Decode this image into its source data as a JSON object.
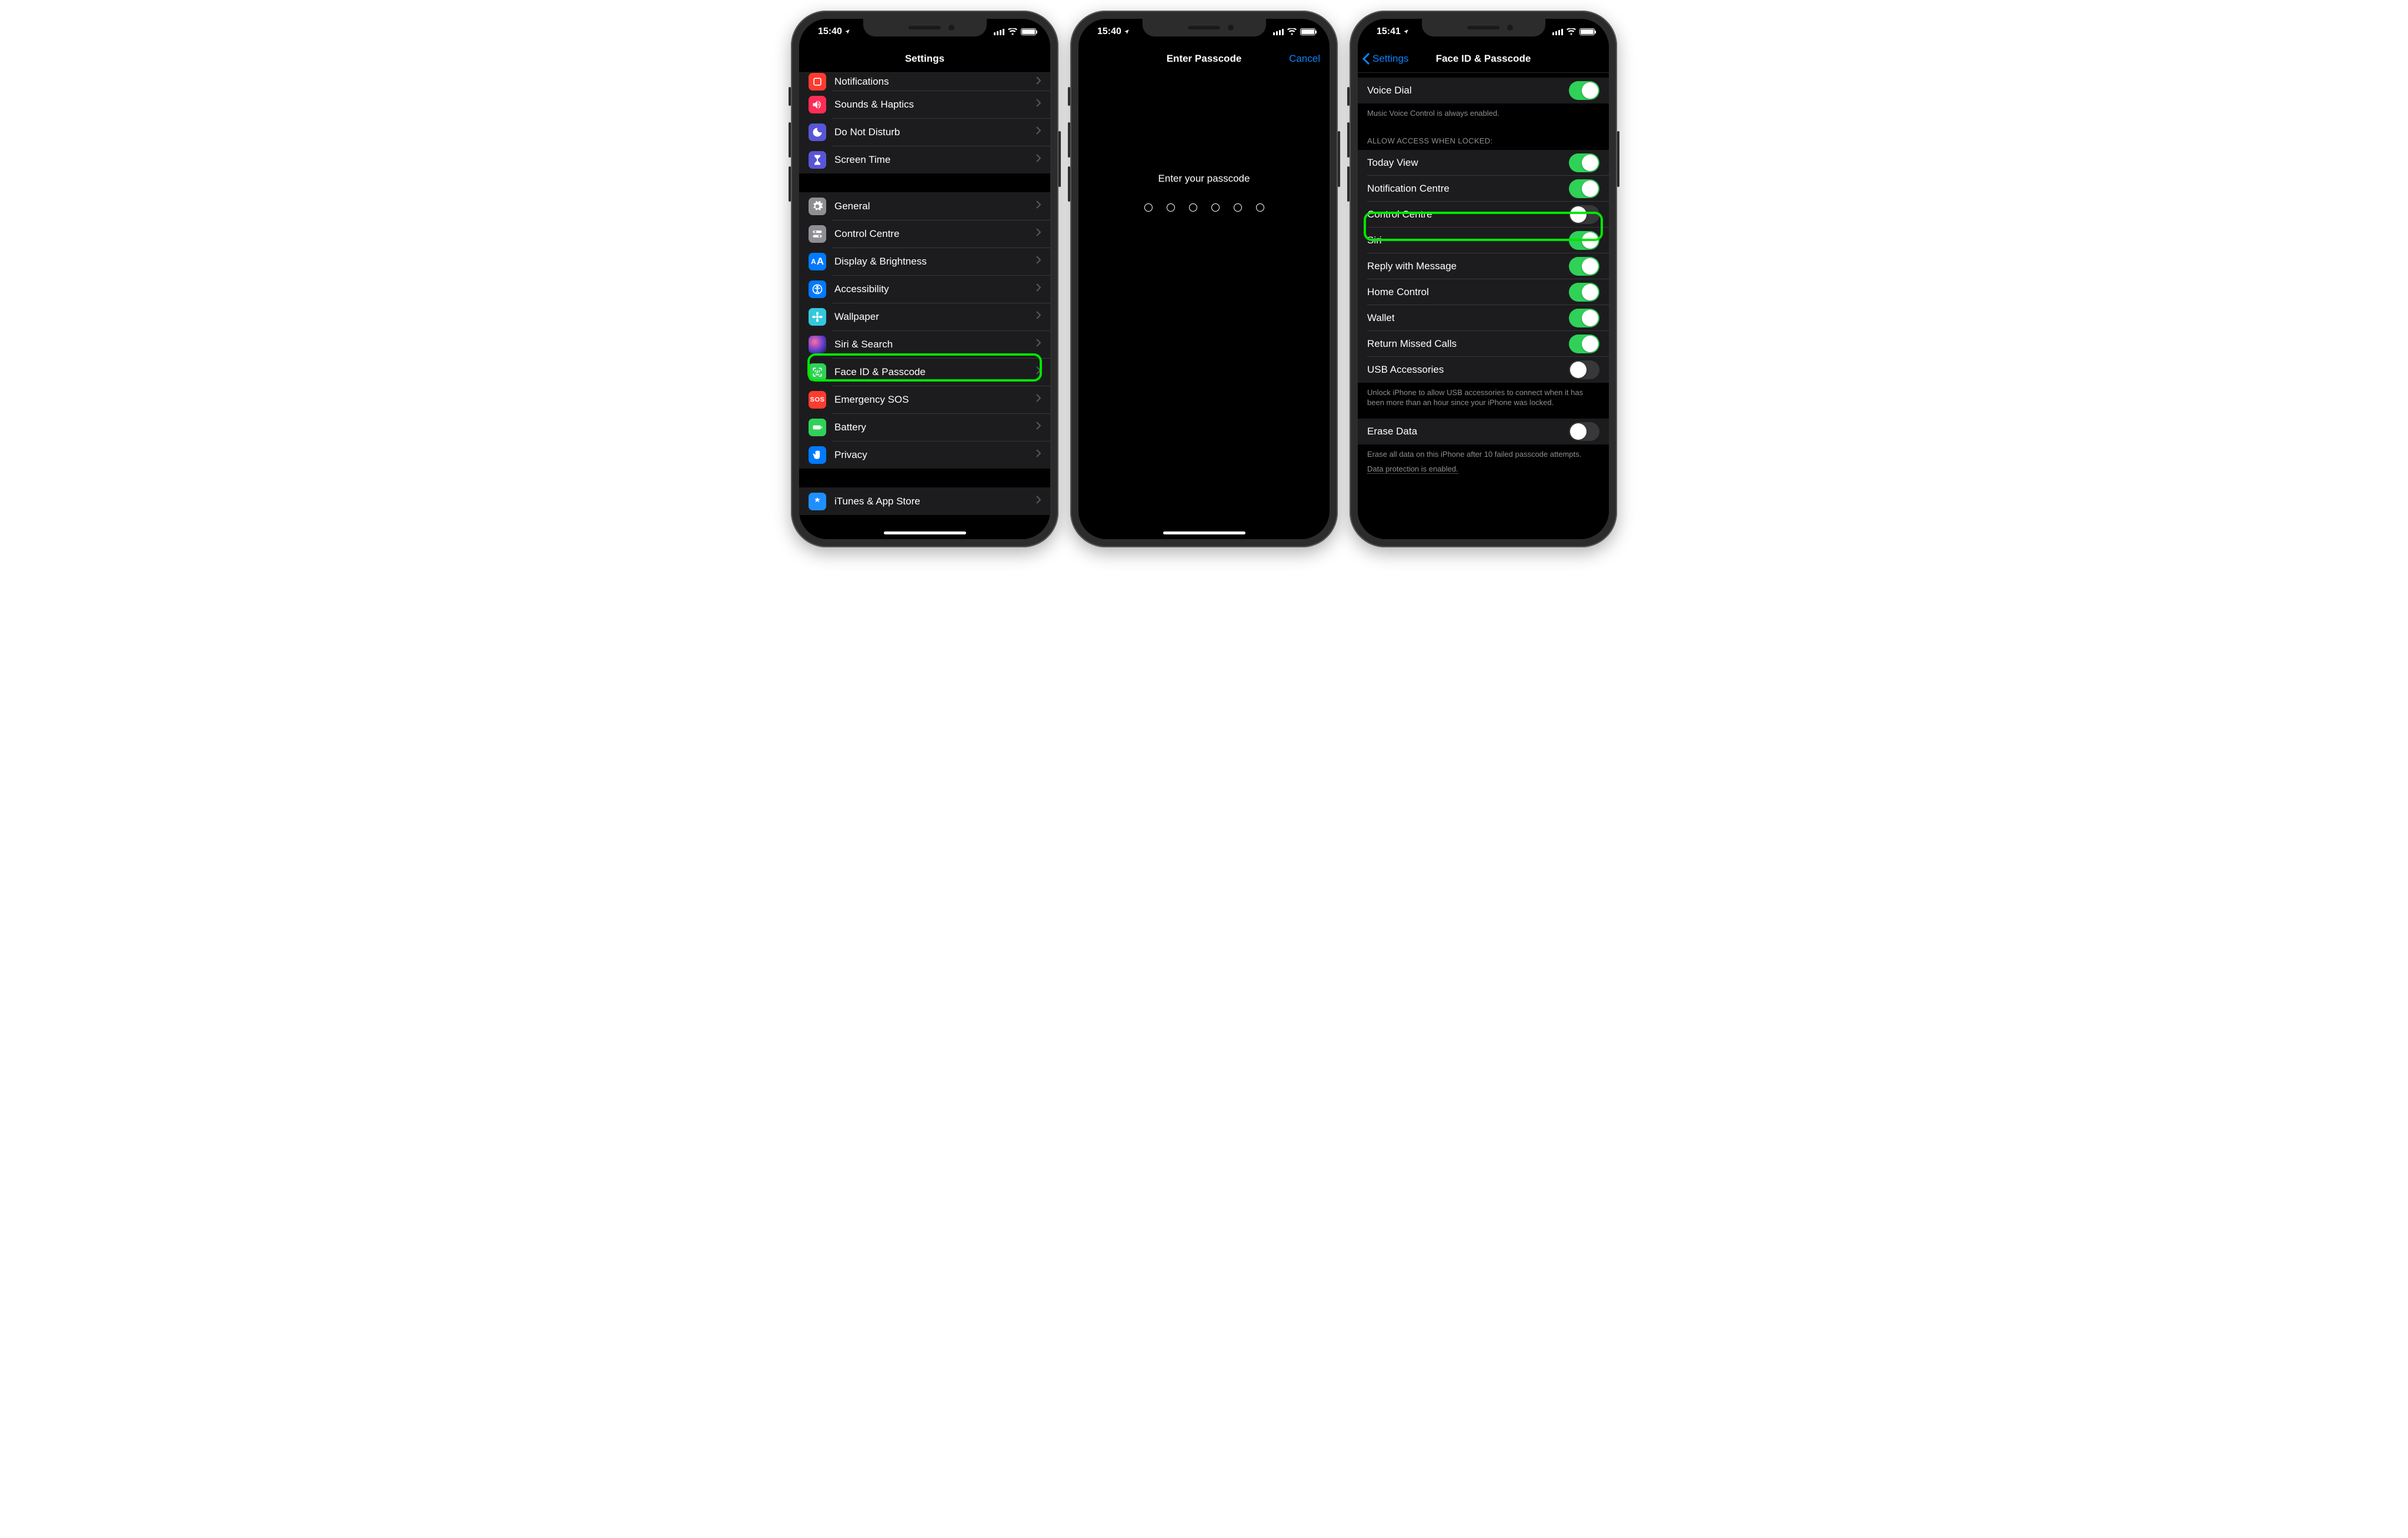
{
  "phone1": {
    "status": {
      "time": "15:40"
    },
    "nav": {
      "title": "Settings"
    },
    "rows": {
      "notifications": "Notifications",
      "sounds": "Sounds & Haptics",
      "dnd": "Do Not Disturb",
      "screentime": "Screen Time",
      "general": "General",
      "controlcentre": "Control Centre",
      "display": "Display & Brightness",
      "accessibility": "Accessibility",
      "wallpaper": "Wallpaper",
      "siri": "Siri & Search",
      "faceid": "Face ID & Passcode",
      "sos": "Emergency SOS",
      "sos_icon": "SOS",
      "battery": "Battery",
      "privacy": "Privacy",
      "itunes": "iTunes & App Store"
    }
  },
  "phone2": {
    "status": {
      "time": "15:40"
    },
    "nav": {
      "title": "Enter Passcode",
      "right": "Cancel"
    },
    "prompt": "Enter your passcode"
  },
  "phone3": {
    "status": {
      "time": "15:41"
    },
    "nav": {
      "back": "Settings",
      "title": "Face ID & Passcode"
    },
    "voicedial": {
      "label": "Voice Dial",
      "footer": "Music Voice Control is always enabled."
    },
    "section_header": "Allow Access When Locked:",
    "rows": {
      "today": "Today View",
      "notif": "Notification Centre",
      "cc": "Control Centre",
      "siri": "Siri",
      "reply": "Reply with Message",
      "home": "Home Control",
      "wallet": "Wallet",
      "missed": "Return Missed Calls",
      "usb": "USB Accessories"
    },
    "usb_footer": "Unlock iPhone to allow USB accessories to connect when it has been more than an hour since your iPhone was locked.",
    "erase": {
      "label": "Erase Data",
      "footer": "Erase all data on this iPhone after 10 failed passcode attempts.",
      "protection": "Data protection is enabled."
    }
  }
}
